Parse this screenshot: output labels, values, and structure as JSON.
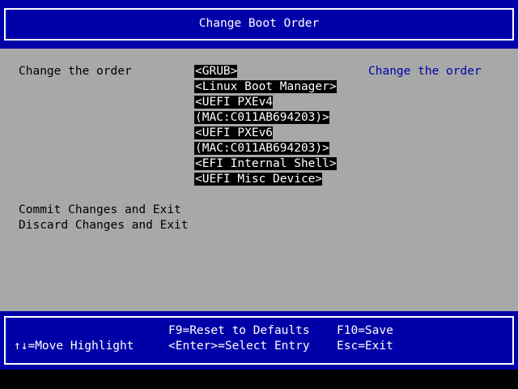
{
  "title": "Change Boot Order",
  "main": {
    "left_label": "Change the order",
    "help_text": "Change the order",
    "boot_options": [
      "<GRUB>",
      "<Linux Boot Manager>",
      "<UEFI PXEv4",
      "(MAC:C011AB694203)>",
      "<UEFI PXEv6",
      "(MAC:C011AB694203)>",
      "<EFI Internal Shell>",
      "<UEFI Misc Device>"
    ],
    "commit_label": "Commit Changes and Exit",
    "discard_label": "Discard Changes and Exit"
  },
  "footer": {
    "f9": "F9=Reset to Defaults",
    "f10": "F10=Save",
    "move": "↑↓=Move Highlight",
    "enter": "<Enter>=Select Entry",
    "esc": "Esc=Exit"
  },
  "colors": {
    "title_bg": "#0000a8",
    "main_bg": "#a8a8a8",
    "highlight_bg": "#000000",
    "help_text": "#0000a8",
    "text": "#000000"
  }
}
